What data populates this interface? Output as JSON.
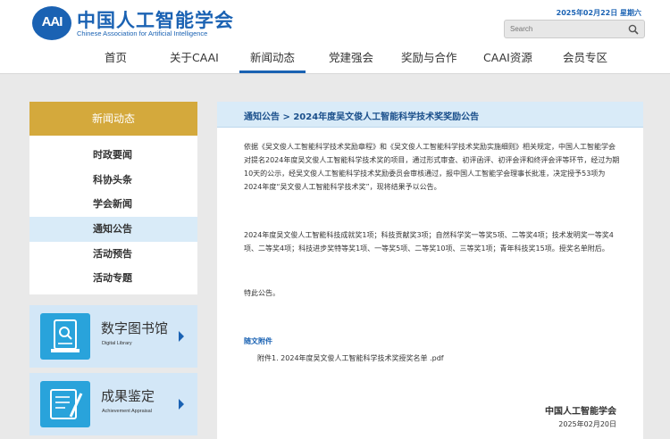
{
  "header": {
    "logo_mark": "AAI",
    "org_name_cn": "中国人工智能学会",
    "org_name_en": "Chinese Association for Artificial Intelligence",
    "date": "2025年02月22日 星期六",
    "search_placeholder": "Search",
    "brand_color": "#1a62b3"
  },
  "nav": {
    "items": [
      {
        "label": "首页"
      },
      {
        "label": "关于CAAI"
      },
      {
        "label": "新闻动态"
      },
      {
        "label": "党建强会"
      },
      {
        "label": "奖励与合作"
      },
      {
        "label": "CAAI资源"
      },
      {
        "label": "会员专区"
      }
    ],
    "active": "新闻动态"
  },
  "sidebar": {
    "title": "新闻动态",
    "items": [
      {
        "label": "时政要闻"
      },
      {
        "label": "科协头条"
      },
      {
        "label": "学会新闻"
      },
      {
        "label": "通知公告"
      },
      {
        "label": "活动预告"
      },
      {
        "label": "活动专题"
      }
    ],
    "active": "通知公告",
    "cards": [
      {
        "title": "数字图书馆",
        "subtitle": "Digital Library",
        "icon": "library-icon"
      },
      {
        "title": "成果鉴定",
        "subtitle": "Achievement Appraisal",
        "icon": "certificate-icon"
      }
    ]
  },
  "article": {
    "breadcrumb": "通知公告 > 2024年度吴文俊人工智能科学技术奖奖励公告",
    "paragraphs": [
      "依据《吴文俊人工智能科学技术奖励章程》和《吴文俊人工智能科学技术奖励实施细则》相关规定，中国人工智能学会对提名2024年度吴文俊人工智能科学技术奖的项目，通过形式审查、初评函评、初评会评和终评会评等环节，经过为期10天的公示，经吴文俊人工智能科学技术奖励委员会审核通过，报中国人工智能学会理事长批准，决定授予53项为2024年度“吴文俊人工智能科学技术奖”，现将结果予以公告。",
      "2024年度吴文俊人工智能科技成就奖1项；科技贡献奖3项；自然科学奖一等奖5项、二等奖4项；技术发明奖一等奖4项、二等奖4项；科技进步奖特等奖1项、一等奖5项、二等奖10项、三等奖1项；青年科技奖15项。授奖名单附后。",
      "特此公告。"
    ],
    "attachment_label": "随文附件",
    "attachment_file": "附件1. 2024年度吴文俊人工智能科学技术奖授奖名单 .pdf",
    "signature_org": "中国人工智能学会",
    "signature_date": "2025年02月20日"
  }
}
